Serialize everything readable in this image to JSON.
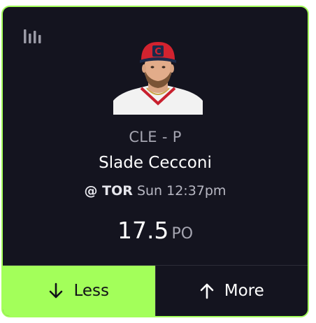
{
  "card": {
    "accent_color": "#a3ff5a",
    "background_color": "#14141f",
    "stats_icon": "bar-chart-icon"
  },
  "player": {
    "team_position": "CLE - P",
    "name": "Slade Cecconi",
    "opponent": "@ TOR",
    "game_time": "Sun 12:37pm",
    "headshot_icon": "player-headshot",
    "cap_logo": "C"
  },
  "projection": {
    "value": "17.5",
    "stat": "PO"
  },
  "buttons": {
    "less_label": "Less",
    "less_icon": "arrow-down-icon",
    "more_label": "More",
    "more_icon": "arrow-up-icon"
  }
}
